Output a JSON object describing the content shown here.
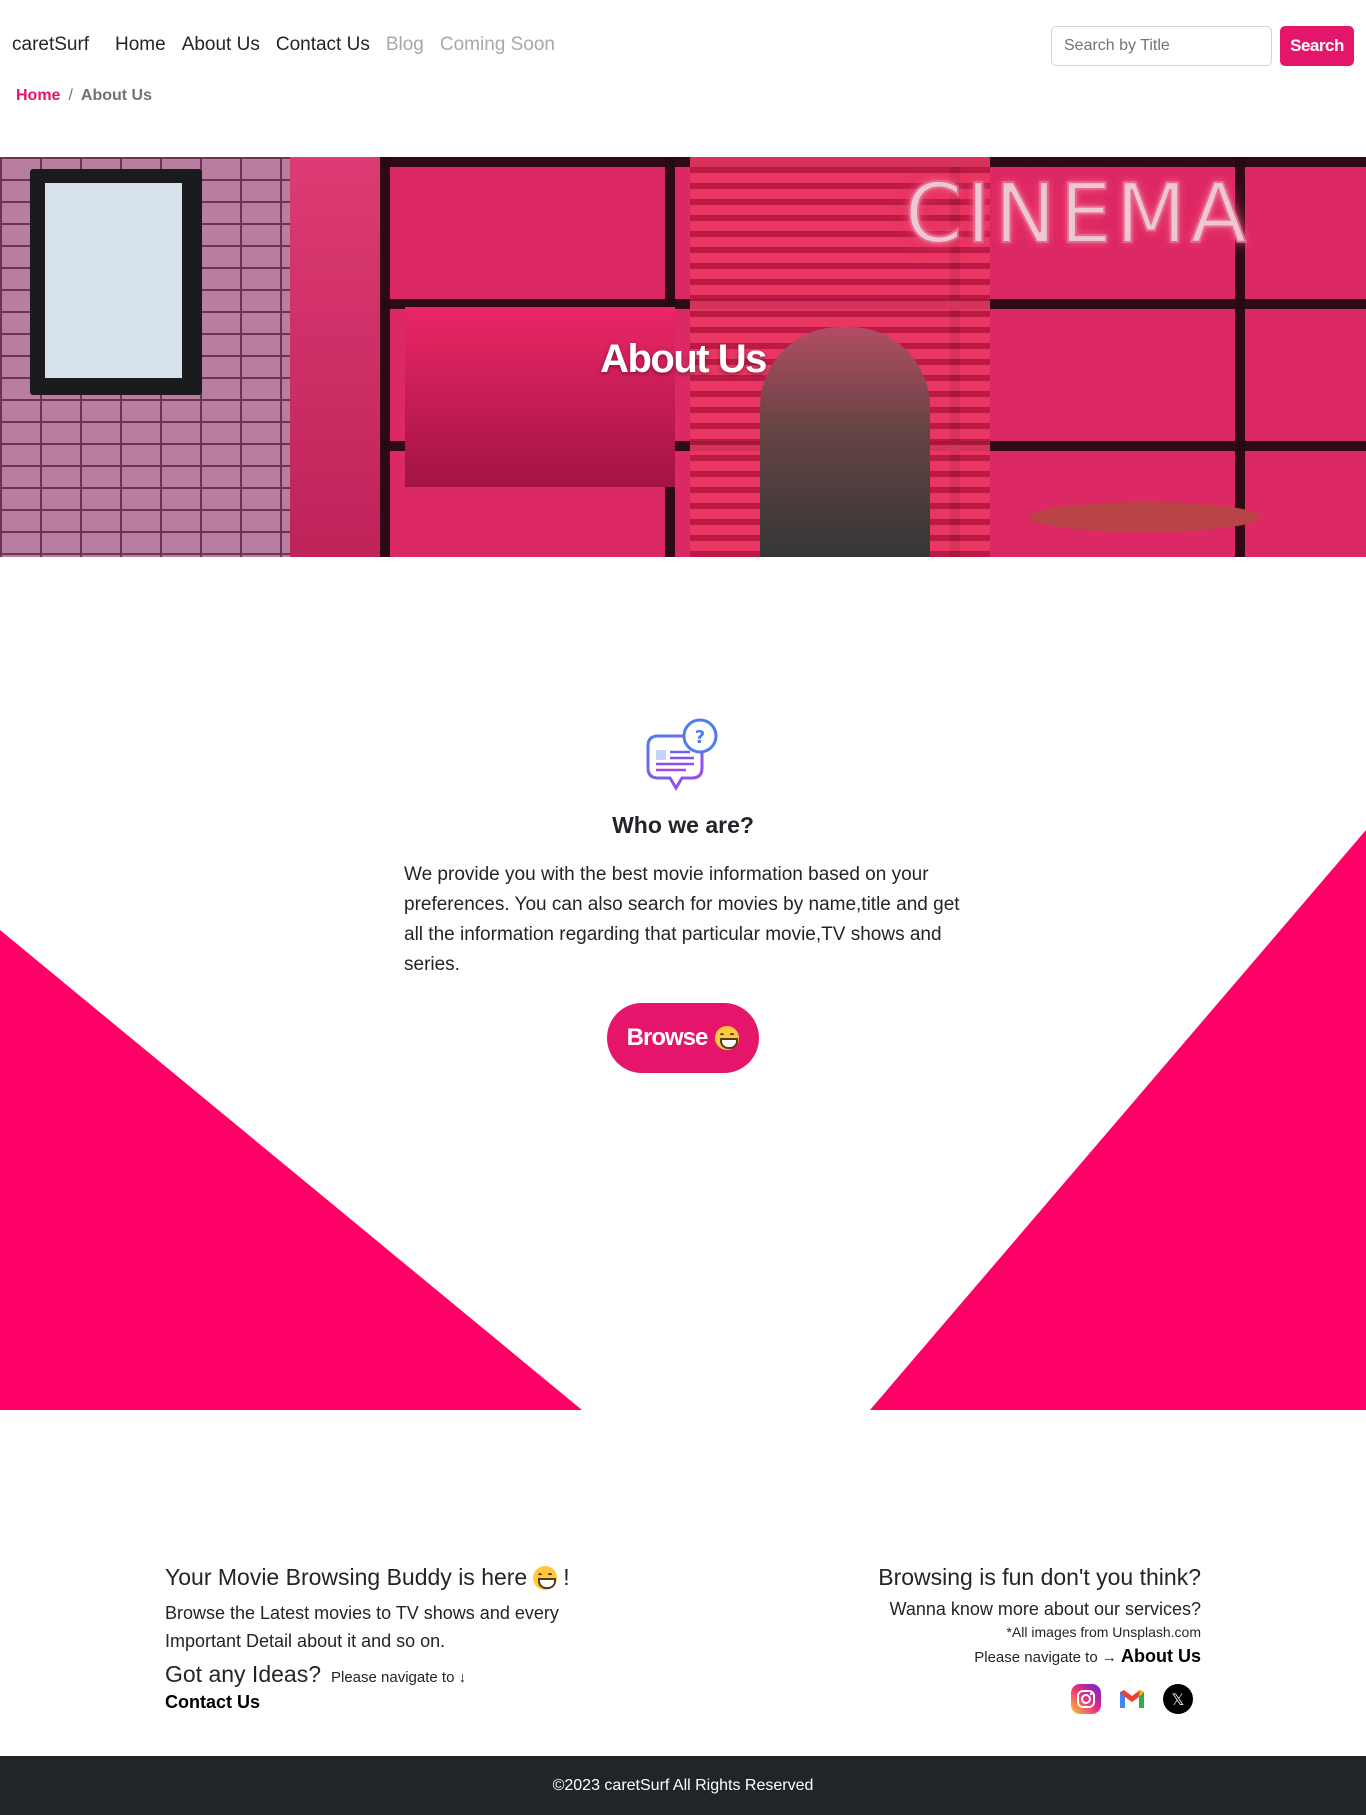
{
  "navbar": {
    "brand": "caretSurf",
    "links": [
      {
        "label": "Home"
      },
      {
        "label": "About Us"
      },
      {
        "label": "Contact Us"
      },
      {
        "label": "Blog"
      },
      {
        "label": "Coming Soon"
      }
    ],
    "search_placeholder": "Search by Title",
    "search_button": "Search"
  },
  "breadcrumb": {
    "home": "Home",
    "separator": "/",
    "current": "About Us"
  },
  "hero": {
    "title": "About Us",
    "sign_text": "CINEMA"
  },
  "about": {
    "heading": "Who we are?",
    "text": "We provide you with the best movie information based on your preferences. You can also search for movies by name,title and get all the information regarding that particular movie,TV shows and series.",
    "browse_button": "Browse"
  },
  "footer": {
    "left_heading": "Your Movie Browsing Buddy is here",
    "left_heading_suffix": "!",
    "left_text": "Browse the Latest movies to TV shows and every Important Detail about it and so on.",
    "ideas_heading": "Got any Ideas?",
    "ideas_small": "Please navigate to ↓",
    "contact_link": "Contact Us",
    "right_heading": "Browsing is fun don't you think?",
    "right_text": "Wanna know more about our services?",
    "right_note": "*All images from Unsplash.com",
    "right_nav": "Please navigate to →",
    "about_link": "About Us",
    "socials": [
      "instagram-icon",
      "gmail-icon",
      "x-icon"
    ],
    "copyright": "©2023 caretSurf All Rights Reserved"
  },
  "colors": {
    "accent": "#e5156c",
    "triangle": "#ff0066",
    "footer_bar": "#212529"
  }
}
